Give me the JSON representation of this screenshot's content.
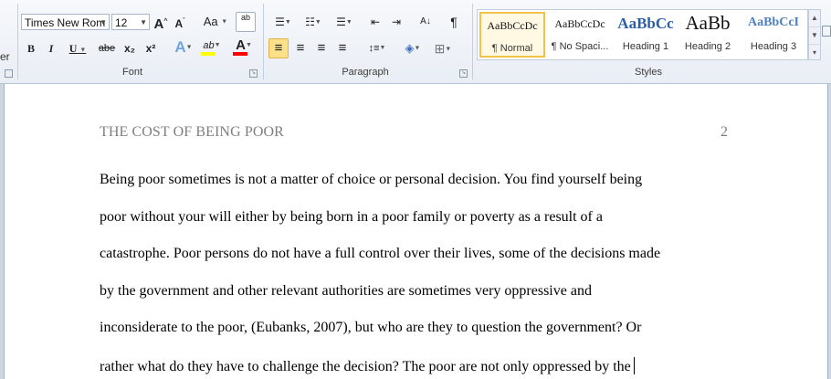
{
  "ribbon": {
    "edge_label": "er",
    "font": {
      "name": "Times New Rom",
      "size": "12",
      "grow": "A",
      "shrink": "A",
      "change_case": "Aa",
      "clear": "ab",
      "bold": "B",
      "italic": "I",
      "underline": "U",
      "strike": "abe",
      "subscript": "x₂",
      "superscript": "x²",
      "effects": "A",
      "highlight": "ab",
      "color": "A",
      "group_label": "Font"
    },
    "paragraph": {
      "bullets": "☰",
      "numbering": "☷",
      "multilevel": "☰",
      "dec_indent": "⇤",
      "inc_indent": "⇥",
      "sort": "A↓",
      "pilcrow": "¶",
      "align_left": "≡",
      "center": "≡",
      "align_right": "≡",
      "justify": "≡",
      "line_spacing": "↕≡",
      "shading": "◈",
      "borders": "⊞",
      "group_label": "Paragraph"
    },
    "styles": {
      "tiles": [
        {
          "sample": "AaBbCcDc",
          "name": "¶ Normal"
        },
        {
          "sample": "AaBbCcDc",
          "name": "¶ No Spaci..."
        },
        {
          "sample": "AaBbCc",
          "name": "Heading 1"
        },
        {
          "sample": "AaBb",
          "name": "Heading 2"
        },
        {
          "sample": "AaBbCcI",
          "name": "Heading 3"
        }
      ],
      "group_label": "Styles"
    },
    "colors": {
      "highlight_bar": "#ffff00",
      "font_color_bar": "#ff0000",
      "heading_blue": "#2a5ea9",
      "selected_tile_border": "#f1c34a"
    }
  },
  "document": {
    "header_title": "THE COST OF BEING POOR",
    "page_number": "2",
    "lines": [
      "Being poor sometimes is not a matter of choice or personal decision. You find yourself being",
      "poor without your will either by being born in a poor family or poverty as a result of a",
      "catastrophe. Poor persons do not have a full control over their lives, some of the decisions made",
      "by the government and other relevant authorities are sometimes very oppressive and",
      "inconsiderate to the poor, (Eubanks, 2007), but who are they to question the government? Or",
      "rather what do they have to challenge the decision? The poor are not only oppressed by the"
    ]
  }
}
